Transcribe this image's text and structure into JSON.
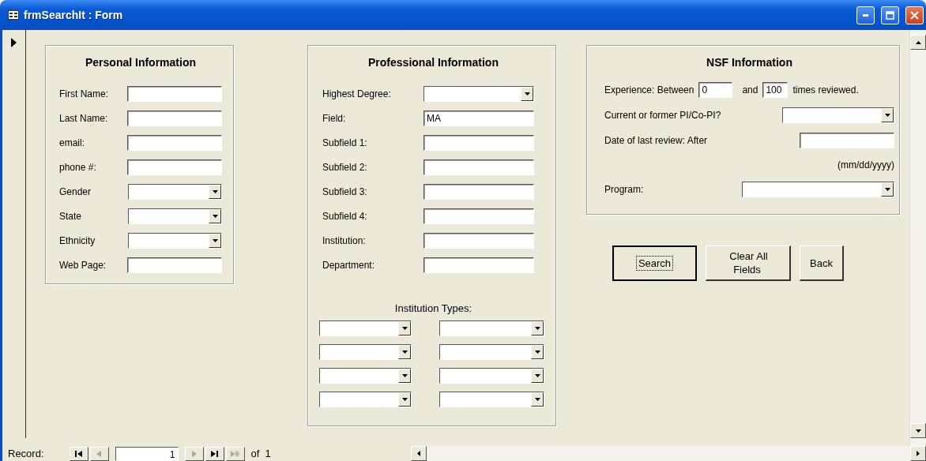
{
  "window": {
    "title": "frmSearchIt : Form"
  },
  "personal": {
    "title": "Personal Information",
    "fields": [
      {
        "label": "First Name:",
        "kind": "text"
      },
      {
        "label": "Last Name:",
        "kind": "text"
      },
      {
        "label": "email:",
        "kind": "text"
      },
      {
        "label": "phone #:",
        "kind": "text"
      },
      {
        "label": "Gender",
        "kind": "dropdown"
      },
      {
        "label": "State",
        "kind": "dropdown"
      },
      {
        "label": "Ethnicity",
        "kind": "dropdown"
      },
      {
        "label": "Web Page:",
        "kind": "text"
      }
    ]
  },
  "professional": {
    "title": "Professional Information",
    "fields": [
      {
        "label": "Highest Degree:",
        "kind": "dropdown"
      },
      {
        "label": "Field:",
        "kind": "text",
        "value": "MA"
      },
      {
        "label": "Subfield 1:",
        "kind": "text"
      },
      {
        "label": "Subfield 2:",
        "kind": "text"
      },
      {
        "label": "Subfield 3:",
        "kind": "text"
      },
      {
        "label": "Subfield 4:",
        "kind": "text"
      },
      {
        "label": "Institution:",
        "kind": "text"
      },
      {
        "label": "Department:",
        "kind": "text"
      }
    ],
    "institution_types": {
      "label": "Institution Types:",
      "dropdowns": [
        {
          "kind": "dropdown"
        },
        {
          "kind": "dropdown"
        },
        {
          "kind": "dropdown"
        },
        {
          "kind": "dropdown"
        },
        {
          "kind": "dropdown"
        },
        {
          "kind": "dropdown"
        },
        {
          "kind": "dropdown"
        },
        {
          "kind": "dropdown"
        }
      ]
    }
  },
  "nsf": {
    "title": "NSF Information",
    "experience": {
      "label": "Experience: Between",
      "min": "0",
      "joiner": "and",
      "max": "100",
      "suffix": "times reviewed."
    },
    "pi": {
      "label": "Current or former PI/Co-PI?",
      "kind": "dropdown"
    },
    "date": {
      "label": "Date of last review: After",
      "kind": "text",
      "hint": "(mm/dd/yyyy)"
    },
    "program": {
      "label": "Program:",
      "kind": "dropdown"
    }
  },
  "buttons": [
    {
      "label": "Search",
      "focused": true
    },
    {
      "label": "Clear All Fields",
      "focused": false
    },
    {
      "label": "Back",
      "focused": false
    }
  ],
  "navigation": {
    "label": "Record:",
    "current": "1",
    "total": "of  1",
    "buttons": [
      {
        "kind": "first",
        "disabled": false
      },
      {
        "kind": "prev",
        "disabled": true
      },
      {
        "kind": "field"
      },
      {
        "kind": "next",
        "disabled": true
      },
      {
        "kind": "last",
        "disabled": false
      },
      {
        "kind": "new",
        "disabled": true
      }
    ]
  }
}
